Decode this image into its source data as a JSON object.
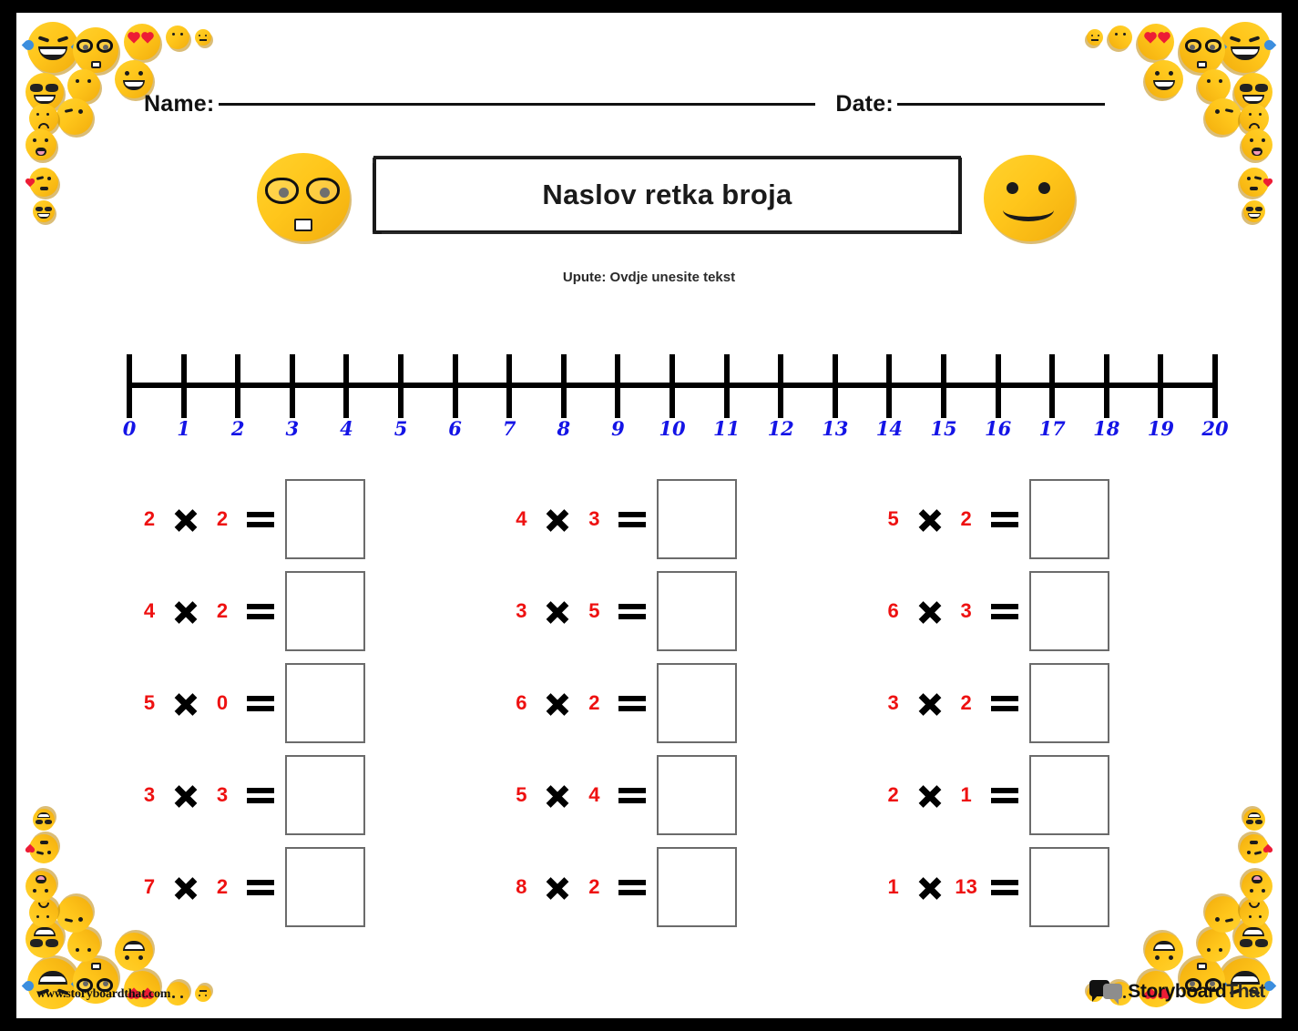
{
  "page": {
    "background_color": "#000000",
    "sheet_color": "#ffffff",
    "accent_red": "#ee1111",
    "number_color": "#1414e6"
  },
  "header": {
    "name_label": "Name:",
    "date_label": "Date:",
    "title": "Naslov retka broja",
    "instructions": "Upute: Ovdje unesite tekst",
    "mascot_left": "nerd-face-emoji",
    "mascot_right": "smiley-face-emoji"
  },
  "number_line": {
    "min": 0,
    "max": 20,
    "labels": [
      "0",
      "1",
      "2",
      "3",
      "4",
      "5",
      "6",
      "7",
      "8",
      "9",
      "10",
      "11",
      "12",
      "13",
      "14",
      "15",
      "16",
      "17",
      "18",
      "19",
      "20"
    ]
  },
  "problems": {
    "operator": "×",
    "equals": "=",
    "items": [
      {
        "a": "2",
        "b": "2",
        "answer": ""
      },
      {
        "a": "4",
        "b": "3",
        "answer": ""
      },
      {
        "a": "5",
        "b": "2",
        "answer": ""
      },
      {
        "a": "4",
        "b": "2",
        "answer": ""
      },
      {
        "a": "3",
        "b": "5",
        "answer": ""
      },
      {
        "a": "6",
        "b": "3",
        "answer": ""
      },
      {
        "a": "5",
        "b": "0",
        "answer": ""
      },
      {
        "a": "6",
        "b": "2",
        "answer": ""
      },
      {
        "a": "3",
        "b": "2",
        "answer": ""
      },
      {
        "a": "3",
        "b": "3",
        "answer": ""
      },
      {
        "a": "5",
        "b": "4",
        "answer": ""
      },
      {
        "a": "2",
        "b": "1",
        "answer": ""
      },
      {
        "a": "7",
        "b": "2",
        "answer": ""
      },
      {
        "a": "8",
        "b": "2",
        "answer": ""
      },
      {
        "a": "1",
        "b": "13",
        "answer": ""
      }
    ]
  },
  "footer": {
    "site_url": "www.storyboardthat.com",
    "logo_storyboard": "Storyboard",
    "logo_that": "That"
  }
}
